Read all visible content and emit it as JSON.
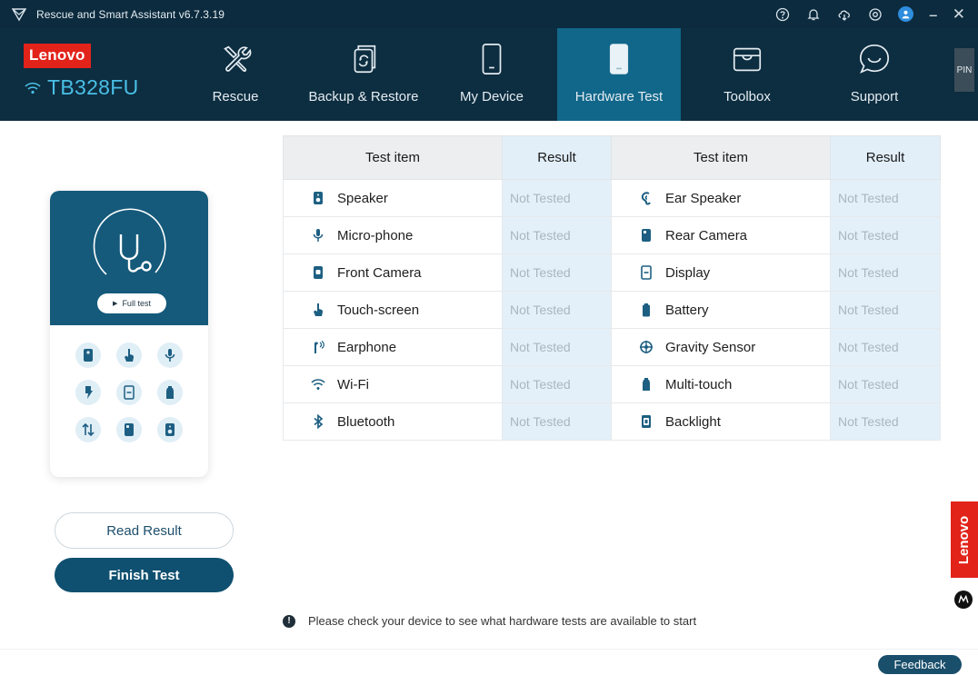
{
  "titlebar": {
    "app_title": "Rescue and Smart Assistant v6.7.3.19",
    "icons": [
      "app-logo-icon",
      "help-icon",
      "bell-icon",
      "cloud-download-icon",
      "settings-icon",
      "user-icon",
      "minimize-icon",
      "close-icon"
    ],
    "minimize": "–",
    "close": "✕"
  },
  "brand": {
    "logo": "Lenovo",
    "device_name": "TB328FU"
  },
  "nav": {
    "items": [
      {
        "label": "Rescue",
        "icon": "tools-icon"
      },
      {
        "label": "Backup & Restore",
        "icon": "backup-icon"
      },
      {
        "label": "My Device",
        "icon": "phone-icon"
      },
      {
        "label": "Hardware Test",
        "icon": "hardware-test-icon",
        "active": true
      },
      {
        "label": "Toolbox",
        "icon": "toolbox-icon"
      },
      {
        "label": "Support",
        "icon": "chat-support-icon"
      }
    ],
    "pin": "PIN"
  },
  "card": {
    "full_test": "Full test",
    "grid_icons": [
      "front-camera-icon",
      "touch-icon",
      "microphone-icon",
      "flash-icon",
      "display-icon",
      "multitouch-icon",
      "data-transfer-icon",
      "rear-camera-icon",
      "speaker-icon"
    ]
  },
  "buttons": {
    "read_result": "Read Result",
    "finish_test": "Finish Test",
    "feedback": "Feedback"
  },
  "table": {
    "headers": {
      "item": "Test item",
      "result": "Result"
    },
    "rows": [
      {
        "left": {
          "label": "Speaker",
          "result": "Not Tested"
        },
        "right": {
          "label": "Ear Speaker",
          "result": "Not Tested"
        }
      },
      {
        "left": {
          "label": "Micro-phone",
          "result": "Not Tested"
        },
        "right": {
          "label": "Rear Camera",
          "result": "Not Tested"
        }
      },
      {
        "left": {
          "label": "Front Camera",
          "result": "Not Tested"
        },
        "right": {
          "label": "Display",
          "result": "Not Tested"
        }
      },
      {
        "left": {
          "label": "Touch-screen",
          "result": "Not Tested"
        },
        "right": {
          "label": "Battery",
          "result": "Not Tested"
        }
      },
      {
        "left": {
          "label": "Earphone",
          "result": "Not Tested"
        },
        "right": {
          "label": "Gravity Sensor",
          "result": "Not Tested"
        }
      },
      {
        "left": {
          "label": "Wi-Fi",
          "result": "Not Tested"
        },
        "right": {
          "label": "Multi-touch",
          "result": "Not Tested"
        }
      },
      {
        "left": {
          "label": "Bluetooth",
          "result": "Not Tested"
        },
        "right": {
          "label": "Backlight",
          "result": "Not Tested"
        }
      }
    ]
  },
  "notice": {
    "text": "Please check your device to see what hardware tests are available to start"
  },
  "side_brand": {
    "lenovo": "Lenovo",
    "moto": "motorola-logo"
  },
  "colors": {
    "header_bg": "#0d2d40",
    "active_tab": "#11678a",
    "accent_blue": "#49bfe6",
    "brand_red": "#e2231a",
    "primary_button": "#0f5070",
    "result_cell": "#e4f0f9"
  }
}
